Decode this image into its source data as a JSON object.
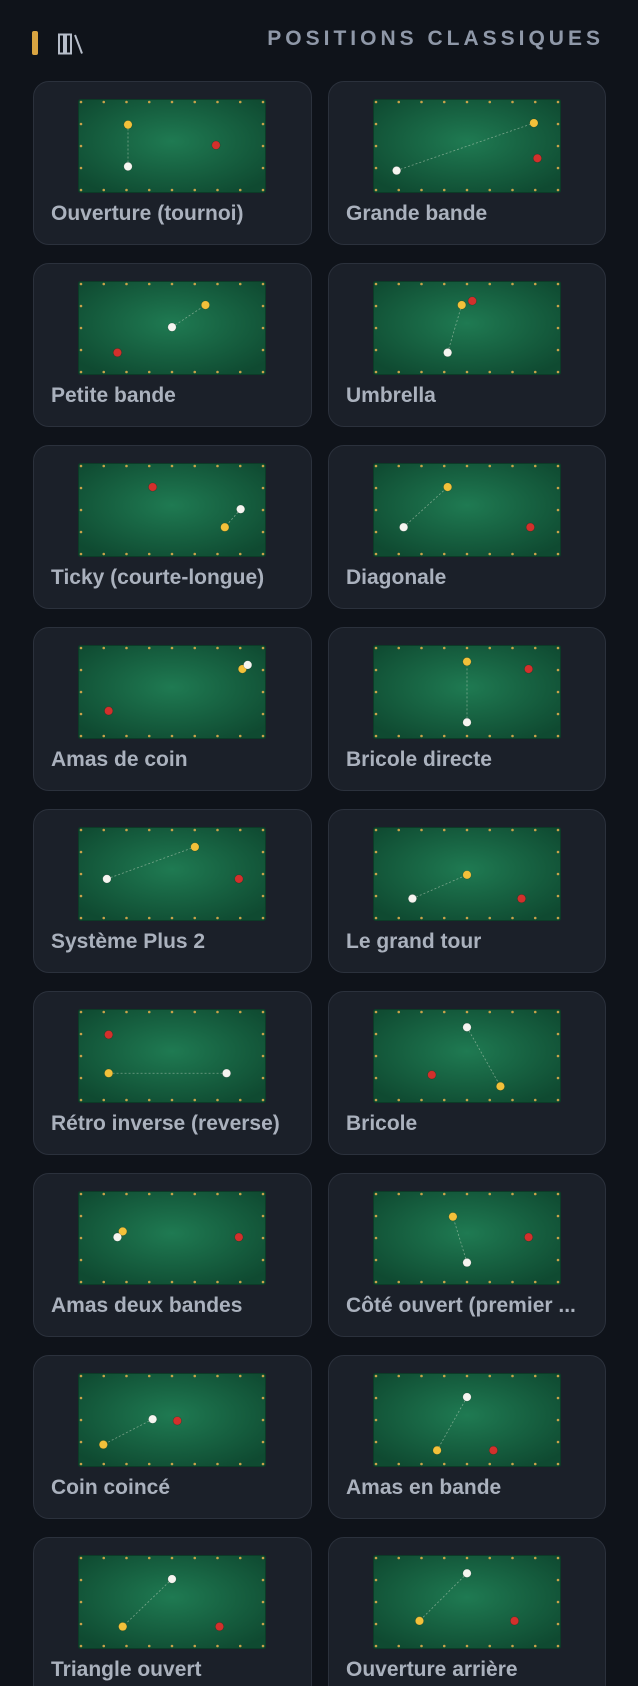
{
  "header": {
    "title": "POSITIONS CLASSIQUES",
    "accent_icon": "accent-bar",
    "menu_icon": "library-icon"
  },
  "colors": {
    "background": "#0f131a",
    "card": "#1b2029",
    "card_border": "#2b313c",
    "accent": "#d9a441",
    "felt_center": "#1f7a52",
    "felt_edge": "#0f4a31",
    "white_ball": "#f5f5f0",
    "yellow_ball": "#f2c13a",
    "red_ball": "#d2302c",
    "diamond": "#c9a24a"
  },
  "positions": [
    {
      "label": "Ouverture (tournoi)",
      "balls": {
        "white": [
          0.25,
          0.75
        ],
        "yellow": [
          0.25,
          0.24
        ],
        "red": [
          0.75,
          0.49
        ]
      },
      "line": [
        "white",
        "yellow"
      ]
    },
    {
      "label": "Grande bande",
      "balls": {
        "white": [
          0.1,
          0.8
        ],
        "yellow": [
          0.88,
          0.22
        ],
        "red": [
          0.9,
          0.65
        ]
      },
      "line": [
        "white",
        "yellow"
      ]
    },
    {
      "label": "Petite bande",
      "balls": {
        "white": [
          0.5,
          0.49
        ],
        "yellow": [
          0.69,
          0.22
        ],
        "red": [
          0.19,
          0.8
        ]
      },
      "line": [
        "white",
        "yellow"
      ]
    },
    {
      "label": "Umbrella",
      "balls": {
        "white": [
          0.39,
          0.8
        ],
        "yellow": [
          0.47,
          0.22
        ],
        "red": [
          0.53,
          0.17
        ]
      },
      "line": [
        "white",
        "yellow"
      ]
    },
    {
      "label": "Ticky (courte-longue)",
      "balls": {
        "white": [
          0.89,
          0.49
        ],
        "yellow": [
          0.8,
          0.71
        ],
        "red": [
          0.39,
          0.22
        ]
      },
      "line": [
        "white",
        "yellow"
      ]
    },
    {
      "label": "Diagonale",
      "balls": {
        "white": [
          0.14,
          0.71
        ],
        "yellow": [
          0.39,
          0.22
        ],
        "red": [
          0.86,
          0.71
        ]
      },
      "line": [
        "white",
        "yellow"
      ]
    },
    {
      "label": "Amas de coin",
      "balls": {
        "white": [
          0.93,
          0.17
        ],
        "yellow": [
          0.9,
          0.22
        ],
        "red": [
          0.14,
          0.73
        ]
      },
      "line": []
    },
    {
      "label": "Bricole directe",
      "balls": {
        "white": [
          0.5,
          0.87
        ],
        "yellow": [
          0.5,
          0.13
        ],
        "red": [
          0.85,
          0.22
        ]
      },
      "line": [
        "white",
        "yellow"
      ]
    },
    {
      "label": "Système Plus 2",
      "balls": {
        "white": [
          0.13,
          0.56
        ],
        "yellow": [
          0.63,
          0.17
        ],
        "red": [
          0.88,
          0.56
        ]
      },
      "line": [
        "white",
        "yellow"
      ]
    },
    {
      "label": "Le grand tour",
      "balls": {
        "white": [
          0.19,
          0.8
        ],
        "yellow": [
          0.5,
          0.51
        ],
        "red": [
          0.81,
          0.8
        ]
      },
      "line": [
        "white",
        "yellow"
      ]
    },
    {
      "label": "Rétro inverse (reverse)",
      "balls": {
        "white": [
          0.81,
          0.71
        ],
        "yellow": [
          0.14,
          0.71
        ],
        "red": [
          0.14,
          0.24
        ]
      },
      "line": [
        "white",
        "yellow"
      ]
    },
    {
      "label": "Bricole",
      "balls": {
        "white": [
          0.5,
          0.15
        ],
        "yellow": [
          0.69,
          0.87
        ],
        "red": [
          0.3,
          0.73
        ]
      },
      "line": [
        "white",
        "yellow"
      ]
    },
    {
      "label": "Amas deux bandes",
      "balls": {
        "white": [
          0.19,
          0.49
        ],
        "yellow": [
          0.22,
          0.42
        ],
        "red": [
          0.88,
          0.49
        ]
      },
      "line": []
    },
    {
      "label": "Côté ouvert (premier ...",
      "balls": {
        "white": [
          0.5,
          0.8
        ],
        "yellow": [
          0.42,
          0.24
        ],
        "red": [
          0.85,
          0.49
        ]
      },
      "line": [
        "white",
        "yellow"
      ]
    },
    {
      "label": "Coin coincé",
      "balls": {
        "white": [
          0.39,
          0.49
        ],
        "yellow": [
          0.11,
          0.8
        ],
        "red": [
          0.53,
          0.51
        ]
      },
      "line": [
        "white",
        "yellow"
      ]
    },
    {
      "label": "Amas en bande",
      "balls": {
        "white": [
          0.5,
          0.22
        ],
        "yellow": [
          0.33,
          0.87
        ],
        "red": [
          0.65,
          0.87
        ]
      },
      "line": [
        "white",
        "yellow"
      ]
    },
    {
      "label": "Triangle ouvert",
      "balls": {
        "white": [
          0.5,
          0.22
        ],
        "yellow": [
          0.22,
          0.8
        ],
        "red": [
          0.77,
          0.8
        ]
      },
      "line": [
        "white",
        "yellow"
      ]
    },
    {
      "label": "Ouverture arrière",
      "balls": {
        "white": [
          0.5,
          0.15
        ],
        "yellow": [
          0.23,
          0.73
        ],
        "red": [
          0.77,
          0.73
        ]
      },
      "line": [
        "white",
        "yellow"
      ]
    }
  ]
}
